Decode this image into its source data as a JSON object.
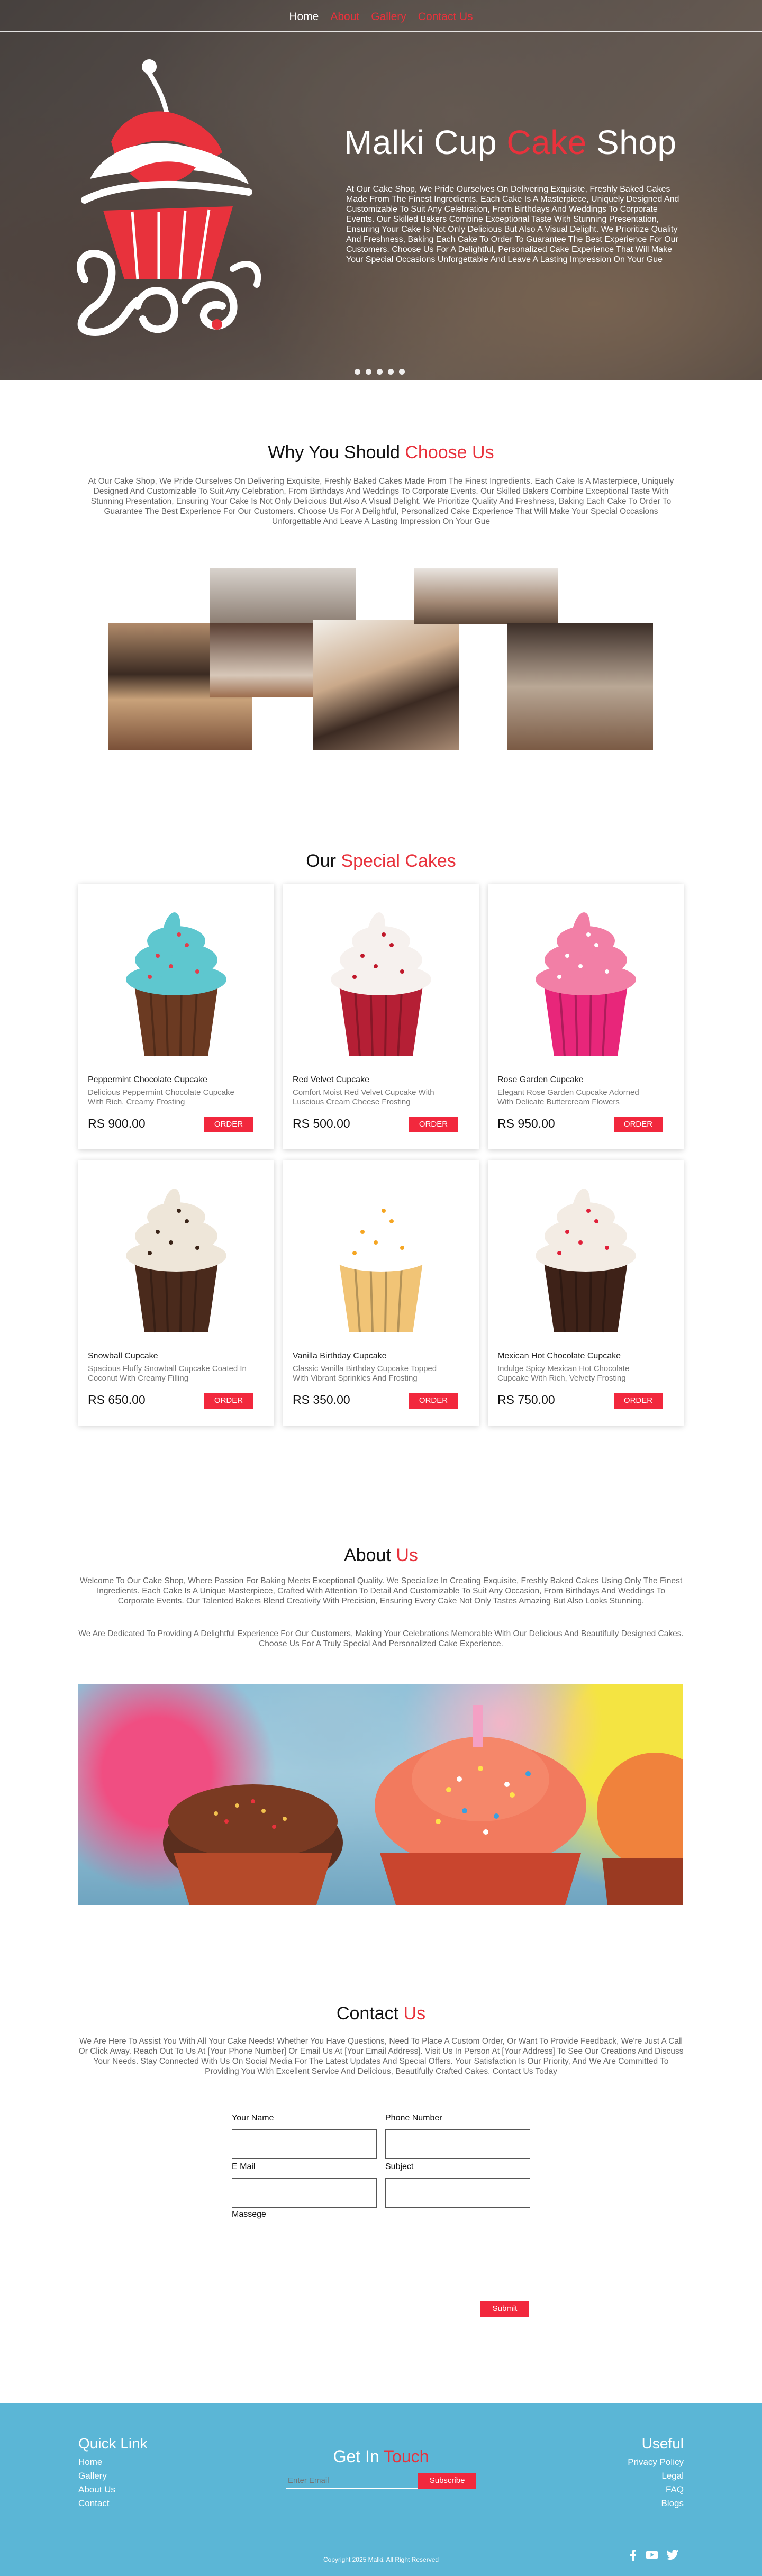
{
  "nav": {
    "items": [
      {
        "label": "Home"
      },
      {
        "label": "About"
      },
      {
        "label": "Gallery"
      },
      {
        "label": "Contact Us"
      }
    ]
  },
  "hero": {
    "title_a": "Malki Cup ",
    "title_b": "Cake",
    "title_c": " Shop",
    "text": "At Our Cake Shop, We Pride Ourselves On Delivering Exquisite, Freshly Baked Cakes Made From The Finest Ingredients. Each Cake Is A Masterpiece, Uniquely Designed And Customizable To Suit Any Celebration, From Birthdays And Weddings To Corporate Events. Our Skilled Bakers Combine Exceptional Taste With Stunning Presentation, Ensuring Your Cake Is Not Only Delicious But Also A Visual Delight. We Prioritize Quality And Freshness, Baking Each Cake To Order To Guarantee The Best Experience For Our Customers. Choose Us For A Delightful, Personalized Cake Experience That Will Make Your Special Occasions Unforgettable And Leave A Lasting Impression On Your Gue",
    "slider_dots": 5
  },
  "why": {
    "title_a": "Why You Should ",
    "title_b": "Choose Us",
    "text": "At Our Cake Shop, We Pride Ourselves On Delivering Exquisite, Freshly Baked Cakes Made From The Finest Ingredients. Each Cake Is A Masterpiece, Uniquely Designed And Customizable To Suit Any Celebration, From Birthdays And Weddings To Corporate Events. Our Skilled Bakers Combine Exceptional Taste With Stunning Presentation, Ensuring Your Cake Is Not Only Delicious But Also A Visual Delight. We Prioritize Quality And Freshness, Baking Each Cake To Order To Guarantee The Best Experience For Our Customers. Choose Us For A Delightful, Personalized Cake Experience That Will Make Your Special Occasions Unforgettable And Leave A Lasting Impression On Your Gue"
  },
  "special": {
    "title_a": "Our ",
    "title_b": "Special Cakes",
    "order_label": "ORDER",
    "products": [
      {
        "name": "Peppermint Chocolate Cupcake",
        "desc": "Delicious Peppermint Chocolate Cupcake With Rich, Creamy Frosting",
        "price": "RS  900.00",
        "frosting": "#5ec7cf",
        "sprinkle": "#e33d4b",
        "cup": "#6b3a22"
      },
      {
        "name": "Red Velvet Cupcake",
        "desc": "Comfort Moist Red Velvet Cupcake With Luscious Cream Cheese Frosting",
        "price": "RS  500.00",
        "frosting": "#f6f1ee",
        "sprinkle": "#c0182a",
        "cup": "#b51f35"
      },
      {
        "name": "Rose Garden Cupcake",
        "desc": "Elegant Rose Garden Cupcake Adorned With Delicate Buttercream Flowers",
        "price": "RS  950.00",
        "frosting": "#f27fa6",
        "sprinkle": "#ffffff",
        "cup": "#e8267a"
      },
      {
        "name": "Snowball Cupcake",
        "desc": "Spacious Fluffy Snowball Cupcake Coated In Coconut With Creamy Filling",
        "price": "RS  650.00",
        "frosting": "#eee6d9",
        "sprinkle": "#3a2418",
        "cup": "#4a2a1c"
      },
      {
        "name": "Vanilla Birthday Cupcake",
        "desc": "Classic Vanilla Birthday Cupcake Topped With Vibrant Sprinkles And Frosting",
        "price": "RS  350.00",
        "frosting": "#ffffff",
        "sprinkle": "#f5a623",
        "cup": "#f1c476"
      },
      {
        "name": "Mexican Hot Chocolate Cupcake",
        "desc": "Indulge Spicy Mexican Hot Chocolate Cupcake With Rich, Velvety Frosting",
        "price": "RS  750.00",
        "frosting": "#f3ece4",
        "sprinkle": "#e0203a",
        "cup": "#3e2218"
      }
    ]
  },
  "about": {
    "title_a": "About ",
    "title_b": "Us",
    "text1": "Welcome To Our Cake Shop, Where Passion For Baking Meets Exceptional Quality. We Specialize In Creating Exquisite, Freshly Baked Cakes Using Only The Finest Ingredients. Each Cake Is A Unique Masterpiece, Crafted With Attention To Detail And Customizable To Suit Any Occasion, From Birthdays And Weddings To Corporate Events. Our Talented Bakers Blend Creativity With Precision, Ensuring Every Cake Not Only Tastes Amazing But Also Looks Stunning.",
    "text2": "We Are Dedicated To Providing A Delightful Experience For Our Customers, Making Your Celebrations Memorable With Our Delicious And Beautifully Designed Cakes. Choose Us For A Truly Special And Personalized Cake Experience."
  },
  "contact": {
    "title_a": "Contact ",
    "title_b": "Us",
    "text": "We Are Here To Assist You With All Your Cake Needs! Whether You Have Questions, Need To Place A Custom Order, Or Want To Provide Feedback, We're Just A Call Or Click Away. Reach Out To Us At [Your Phone Number] Or Email Us At [Your Email Address]. Visit Us In Person At [Your Address] To See Our Creations And Discuss Your Needs. Stay Connected With Us On Social Media For The Latest Updates And Special Offers. Your Satisfaction Is Our Priority, And We Are Committed To Providing You With Excellent Service And Delicious, Beautifully Crafted Cakes. Contact Us Today",
    "labels": {
      "name": "Your Name",
      "phone": "Phone Number",
      "email": "E Mail",
      "subject": "Subject",
      "message": "Massege"
    },
    "submit_label": "Submit"
  },
  "footer": {
    "quick_title": "Quick Link",
    "quick_links": [
      {
        "label": "Home"
      },
      {
        "label": "Gallery"
      },
      {
        "label": "About Us"
      },
      {
        "label": "Contact"
      }
    ],
    "touch_title_a": "Get In ",
    "touch_title_b": "Touch",
    "email_placeholder": "Enter Email",
    "subscribe_label": "Subscribe",
    "useful_title": "Useful",
    "useful_links": [
      {
        "label": "Privacy Policy"
      },
      {
        "label": "Legal"
      },
      {
        "label": "FAQ"
      },
      {
        "label": "Blogs"
      }
    ],
    "copyright": "Copyright 2025 Malki. All Right Reserved",
    "social_icons": [
      "facebook-icon",
      "youtube-icon",
      "twitter-icon"
    ]
  },
  "colors": {
    "accent": "#e8323c",
    "button": "#f2283d",
    "footer": "#5bb6d6"
  }
}
